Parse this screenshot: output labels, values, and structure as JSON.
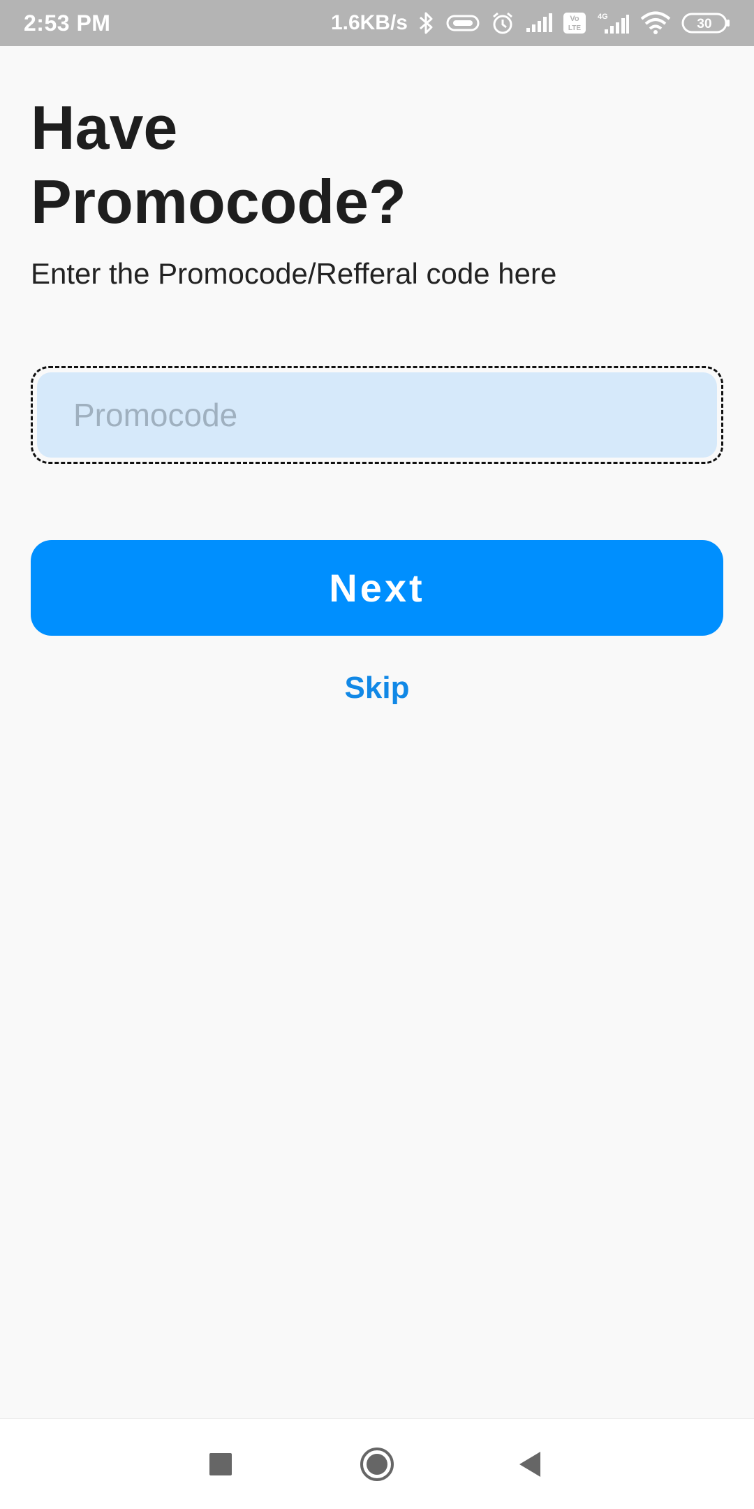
{
  "status_bar": {
    "time": "2:53 PM",
    "network_speed": "1.6KB/s",
    "battery_level": "30",
    "icons": [
      "bluetooth-icon",
      "vibrate-icon",
      "alarm-icon",
      "signal-icon",
      "volte-icon",
      "4g-signal-icon",
      "wifi-icon",
      "battery-icon"
    ],
    "network_type": "4G",
    "volte_label": "Vo LTE"
  },
  "content": {
    "title_line1": "Have",
    "title_line2": "Promocode?",
    "subtitle": "Enter the Promocode/Refferal code here",
    "promo_input": {
      "placeholder": "Promocode",
      "value": ""
    },
    "next_label": "Next",
    "skip_label": "Skip"
  },
  "colors": {
    "primary": "#008ffe",
    "input_bg": "#d6e9fa",
    "link": "#1188e6",
    "status_bar": "#b4b4b4"
  },
  "nav_bar": {
    "icons": [
      "recents-square-icon",
      "home-circle-icon",
      "back-triangle-icon"
    ]
  }
}
